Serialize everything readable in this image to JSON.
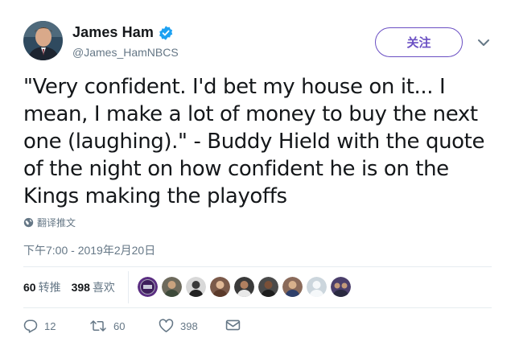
{
  "author": {
    "display_name": "James Ham",
    "handle": "@James_HamNBCS",
    "verified": true
  },
  "follow_button": {
    "label": "关注"
  },
  "tweet": {
    "text": "\"Very confident. I'd bet my house on it... I mean, I make a lot of money to buy the next one (laughing).\" - Buddy Hield with the quote of the night on how confident he is on the Kings making the playoffs",
    "translate_label": "翻译推文",
    "timestamp": "下午7:00 - 2019年2月20日"
  },
  "stats": {
    "retweets_count": "60",
    "retweets_label": "转推",
    "likes_count": "398",
    "likes_label": "喜欢"
  },
  "likers": [
    {
      "icon": "kings-logo-avatar",
      "color": "#5a2d81"
    },
    {
      "icon": "person-avatar",
      "color": "#6d6a5c"
    },
    {
      "icon": "person-avatar",
      "color": "#d8d8d8"
    },
    {
      "icon": "person-avatar",
      "color": "#7b5a4a"
    },
    {
      "icon": "person-avatar",
      "color": "#3a3a3a"
    },
    {
      "icon": "person-avatar",
      "color": "#4a4a4a"
    },
    {
      "icon": "person-avatar",
      "color": "#8a6a5a"
    },
    {
      "icon": "default-avatar",
      "color": "#ccd6dd"
    },
    {
      "icon": "group-avatar",
      "color": "#4b3f6b"
    }
  ],
  "actions": {
    "reply_count": "12",
    "retweet_count": "60",
    "like_count": "398"
  },
  "colors": {
    "accent": "#6a4fc3",
    "verified": "#1da1f2",
    "muted": "#657786",
    "text": "#14171a"
  }
}
